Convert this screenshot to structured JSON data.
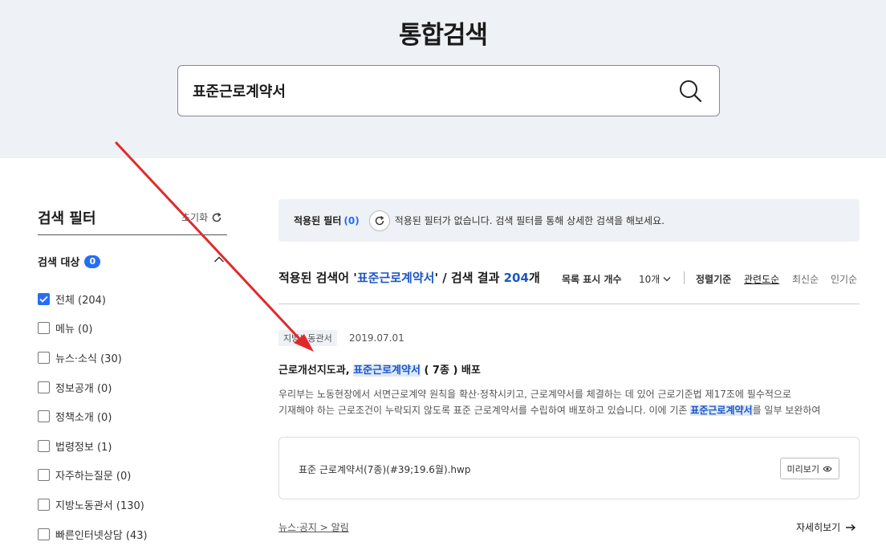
{
  "header": {
    "title": "통합검색"
  },
  "search": {
    "value": "표준근로계약서"
  },
  "filter": {
    "title": "검색 필터",
    "reset_label": "초기화",
    "category_title": "검색 대상",
    "category_badge": "0",
    "items": [
      {
        "label": "전체 (204)",
        "checked": true
      },
      {
        "label": "메뉴 (0)",
        "checked": false
      },
      {
        "label": "뉴스·소식 (30)",
        "checked": false
      },
      {
        "label": "정보공개 (0)",
        "checked": false
      },
      {
        "label": "정책소개 (0)",
        "checked": false
      },
      {
        "label": "법령정보 (1)",
        "checked": false
      },
      {
        "label": "자주하는질문 (0)",
        "checked": false
      },
      {
        "label": "지방노동관서 (130)",
        "checked": false
      },
      {
        "label": "빠른인터넷상담 (43)",
        "checked": false
      }
    ]
  },
  "applied": {
    "label": "적용된 필터",
    "count": "(0)",
    "message": "적용된 필터가 없습니다. 검색 필터를 통해 상세한 검색을 해보세요."
  },
  "results": {
    "prefix": "적용된 검색어 '",
    "keyword": "표준근로계약서",
    "middle": "' / 검색 결과 ",
    "count": "204",
    "suffix": "개",
    "list_count_label": "목록 표시 개수",
    "per_page": "10개",
    "sort_label": "정렬기준",
    "sort_options": [
      "관련도순",
      "최신순",
      "인기순"
    ]
  },
  "item": {
    "tag": "지방노동관서",
    "date": "2019.07.01",
    "title_before": "근로개선지도과, ",
    "title_highlight": "표준근로계약서",
    "title_after": " ( 7종 ) 배포",
    "desc_line1": "우리부는 노동현장에서 서면근로계약 원칙을 확산·정착시키고, 근로계약서를 체결하는 데 있어 근로기준법 제17조에 필수적으로",
    "desc_line2_before": "기재해야 하는 근로조건이 누락되지 않도록 표준 근로계약서를 수립하여 배포하고 있습니다. 이에 기존 ",
    "desc_line2_highlight": "표준근로계약서",
    "desc_line2_after": "를 일부 보완하여",
    "attachment": "표준 근로계약서(7종)(#39;19.6월).hwp",
    "preview_label": "미리보기",
    "breadcrumb": "뉴스·공지 > 알림",
    "more_label": "자세히보기"
  },
  "colors": {
    "accent": "#256ef4",
    "annotation_arrow": "#e02a2a",
    "header_bg": "#eef1f5"
  }
}
